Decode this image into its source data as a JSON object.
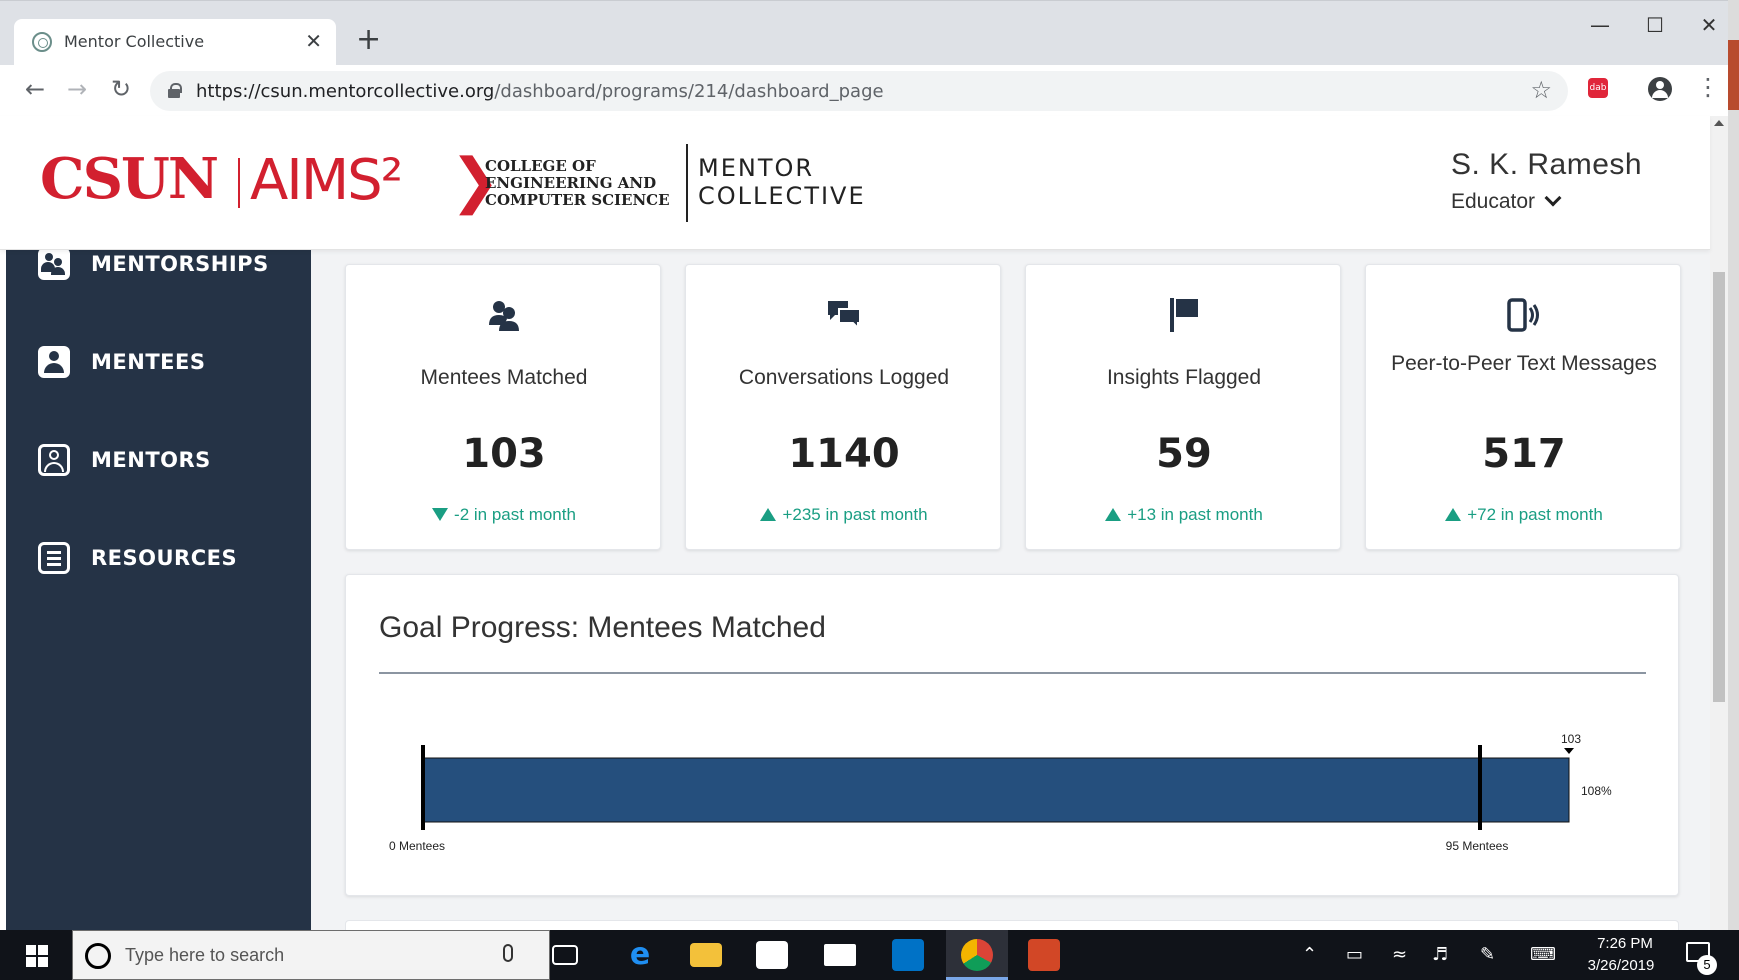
{
  "browser": {
    "tab_title": "Mentor Collective",
    "tab_close": "✕",
    "new_tab": "+",
    "url_host": "https://csun.mentorcollective.org",
    "url_path": "/dashboard/programs/214/dashboard_page",
    "ext_label": "dab"
  },
  "header": {
    "logo_csun": "CSUN",
    "logo_aims": "AIMS²",
    "logo_college": "COLLEGE OF\nENGINEERING AND\nCOMPUTER SCIENCE",
    "logo_mentor": "MENTOR\nCOLLECTIVE",
    "user_name": "S. K. Ramesh",
    "user_role": "Educator"
  },
  "sidebar": {
    "items": [
      {
        "label": "MENTORSHIPS",
        "icon": "mentorships-icon"
      },
      {
        "label": "MENTEES",
        "icon": "mentee-icon"
      },
      {
        "label": "MENTORS",
        "icon": "mentor-icon"
      },
      {
        "label": "RESOURCES",
        "icon": "document-icon"
      }
    ]
  },
  "stats": [
    {
      "icon": "users-icon",
      "label": "Mentees Matched",
      "value": "103",
      "trend": "down",
      "change": "-2 in past month"
    },
    {
      "icon": "chat-icon",
      "label": "Conversations Logged",
      "value": "1140",
      "trend": "up",
      "change": "+235 in past month"
    },
    {
      "icon": "flag-icon",
      "label": "Insights Flagged",
      "value": "59",
      "trend": "up",
      "change": "+13 in past month"
    },
    {
      "icon": "phone-message-icon",
      "label": "Peer-to-Peer Text Messages",
      "value": "517",
      "trend": "up",
      "change": "+72 in past month"
    }
  ],
  "goal": {
    "title": "Goal Progress: Mentees Matched",
    "current": 103,
    "goal": 95,
    "percent_label": "108%",
    "current_label": "103",
    "start_label": "0 Mentees",
    "goal_label": "95 Mentees",
    "bar_color": "#254f7d"
  },
  "taskbar": {
    "search_placeholder": "Type here to search",
    "time": "7:26 PM",
    "date": "3/26/2019",
    "notification_count": "5"
  },
  "colors": {
    "sidebar_bg": "#253346",
    "accent_red": "#d2202f",
    "trend_green": "#1a9e83"
  }
}
